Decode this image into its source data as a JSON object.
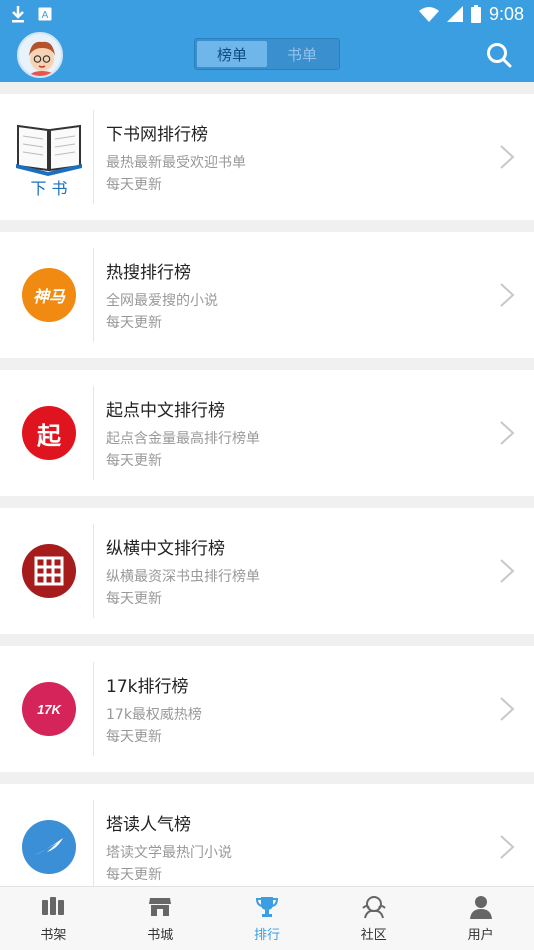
{
  "status_bar": {
    "time": "9:08",
    "icons": [
      "download-icon",
      "a-icon",
      "wifi-icon",
      "signal-icon",
      "battery-icon"
    ]
  },
  "header": {
    "segments": [
      {
        "label": "榜单",
        "active": true
      },
      {
        "label": "书单",
        "active": false
      }
    ],
    "accent": "#3b9ee0"
  },
  "rankings": [
    {
      "title": "下书网排行榜",
      "desc": "最热最新最受欢迎书单",
      "update": "每天更新",
      "logo": "book-logo",
      "logo_text": "下 书",
      "color": "#1a6fc0"
    },
    {
      "title": "热搜排行榜",
      "desc": "全网最爱搜的小说",
      "update": "每天更新",
      "logo": "shenma-logo",
      "logo_text": "神马",
      "color": "#f08a10"
    },
    {
      "title": "起点中文排行榜",
      "desc": "起点含金量最高排行榜单",
      "update": "每天更新",
      "logo": "qidian-logo",
      "logo_text": "起",
      "color": "#e0141e"
    },
    {
      "title": "纵横中文排行榜",
      "desc": "纵横最资深书虫排行榜单",
      "update": "每天更新",
      "logo": "zongheng-logo",
      "logo_text": "",
      "color": "#a61b1b"
    },
    {
      "title": "17k排行榜",
      "desc": "17k最权威热榜",
      "update": "每天更新",
      "logo": "17k-logo",
      "logo_text": "17K",
      "color": "#d4245a"
    },
    {
      "title": "塔读人气榜",
      "desc": "塔读文学最热门小说",
      "update": "每天更新",
      "logo": "tadu-logo",
      "logo_text": "",
      "color": "#3b8fd6"
    }
  ],
  "tabbar": [
    {
      "label": "书架",
      "icon": "bookshelf-icon",
      "active": false
    },
    {
      "label": "书城",
      "icon": "bookstore-icon",
      "active": false
    },
    {
      "label": "排行",
      "icon": "trophy-icon",
      "active": true
    },
    {
      "label": "社区",
      "icon": "community-icon",
      "active": false
    },
    {
      "label": "用户",
      "icon": "user-icon",
      "active": false
    }
  ]
}
